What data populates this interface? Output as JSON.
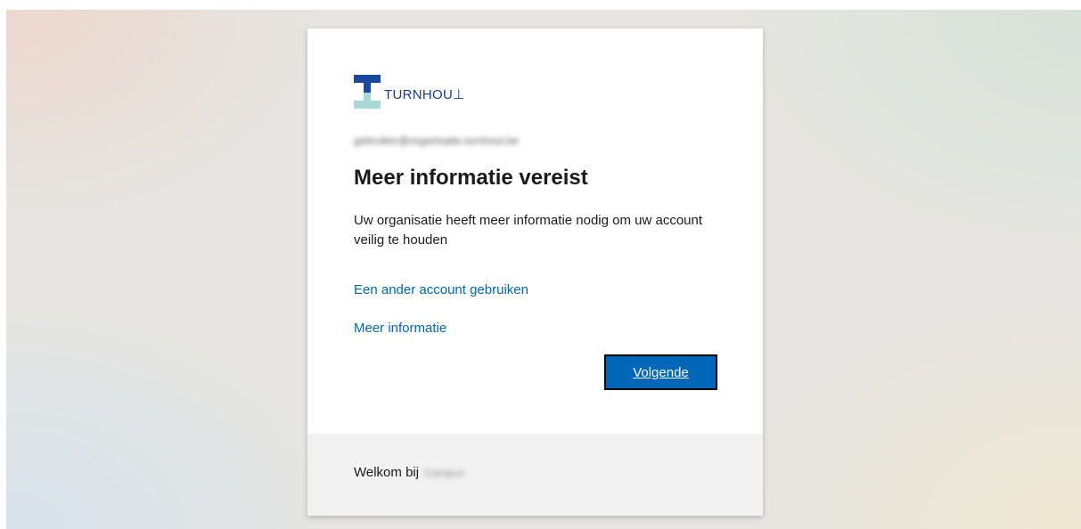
{
  "logo": {
    "text": "TURNHOU⊥",
    "icon": "turnhout-logo-mark",
    "colors": {
      "primary": "#1a4a9f",
      "secondary": "#a9d8d6"
    }
  },
  "account": {
    "email": "gebruiker@organisatie.turnhout.be",
    "redacted": true
  },
  "main": {
    "title": "Meer informatie vereist",
    "description": "Uw organisatie heeft meer informatie nodig om uw account veilig te houden",
    "links": {
      "other_account": "Een ander account gebruiken",
      "more_info": "Meer informatie"
    },
    "next_button": "Volgende"
  },
  "footer": {
    "welcome": "Welkom bij",
    "organization": "Campus",
    "organization_redacted": true
  },
  "colors": {
    "link": "#0067b8",
    "button": "#0067b8",
    "footer_bg": "#f2f2f2"
  }
}
